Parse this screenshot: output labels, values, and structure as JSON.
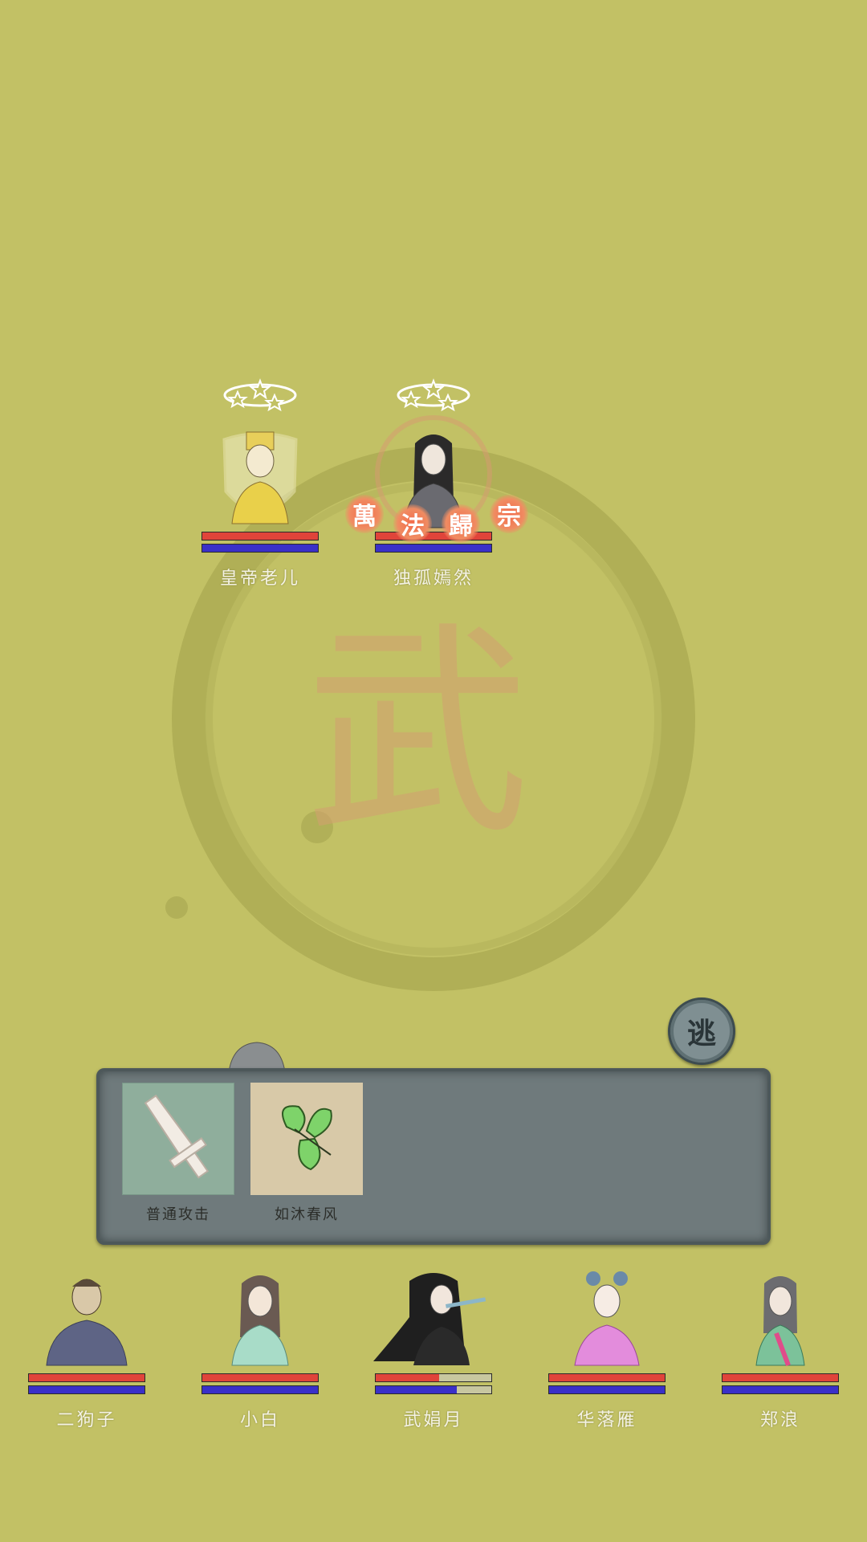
{
  "colors": {
    "background": "#c2c165",
    "hp": "#e0443a",
    "mp": "#3a30c8",
    "panel": "#6f7a7c"
  },
  "enemies": [
    {
      "name": "皇帝老儿",
      "hp": 1.0,
      "mp": 1.0,
      "status": "stunned",
      "shielded": true
    },
    {
      "name": "独孤嫣然",
      "hp": 1.0,
      "mp": 1.0,
      "status": "stunned",
      "shielded": false
    }
  ],
  "skill_banner": [
    "萬",
    "法",
    "歸",
    "宗"
  ],
  "flee_button": {
    "label": "逃"
  },
  "skills": [
    {
      "label": "普通攻击",
      "icon": "sword-icon"
    },
    {
      "label": "如沐春风",
      "icon": "leaf-icon"
    }
  ],
  "allies": [
    {
      "name": "二狗子",
      "hp": 1.0,
      "mp": 1.0
    },
    {
      "name": "小白",
      "hp": 1.0,
      "mp": 1.0
    },
    {
      "name": "武娟月",
      "hp": 0.55,
      "mp": 0.7
    },
    {
      "name": "华落雁",
      "hp": 1.0,
      "mp": 1.0
    },
    {
      "name": "郑浪",
      "hp": 1.0,
      "mp": 1.0
    }
  ]
}
